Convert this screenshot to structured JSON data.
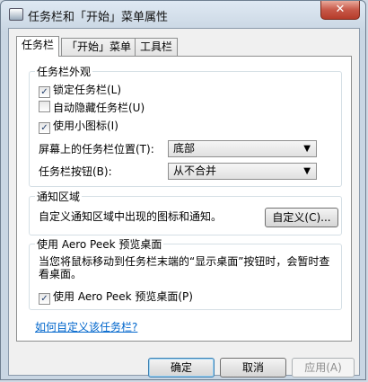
{
  "window": {
    "title": "任务栏和「开始」菜单属性",
    "close_glyph": "✕"
  },
  "tabs": [
    {
      "label": "任务栏",
      "active": true
    },
    {
      "label": "「开始」菜单",
      "active": false
    },
    {
      "label": "工具栏",
      "active": false
    }
  ],
  "appearance": {
    "title": "任务栏外观",
    "lock": {
      "label": "锁定任务栏(L)",
      "checked": true
    },
    "autohide": {
      "label": "自动隐藏任务栏(U)",
      "checked": false
    },
    "small_icons": {
      "label": "使用小图标(I)",
      "checked": true
    },
    "position": {
      "label": "屏幕上的任务栏位置(T):",
      "value": "底部"
    },
    "buttons": {
      "label": "任务栏按钮(B):",
      "value": "从不合并"
    }
  },
  "notification": {
    "title": "通知区域",
    "text": "自定义通知区域中出现的图标和通知。",
    "button": "自定义(C)..."
  },
  "peek": {
    "title": "使用 Aero Peek 预览桌面",
    "description": "当您将鼠标移动到任务栏末端的“显示桌面”按钮时，会暂时查看桌面。",
    "checkbox": {
      "label": "使用 Aero Peek 预览桌面(P)",
      "checked": true
    }
  },
  "help_link": "如何自定义该任务栏?",
  "footer": {
    "ok": "确定",
    "cancel": "取消",
    "apply": "应用(A)"
  },
  "icons": {
    "check": "✓",
    "dropdown": "▼"
  }
}
